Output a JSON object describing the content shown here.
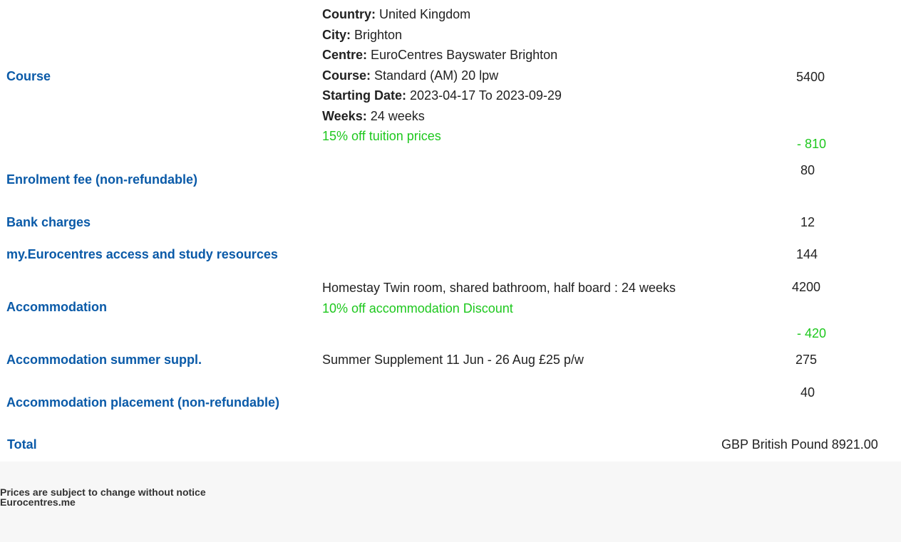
{
  "course": {
    "label": "Course",
    "country_key": "Country:",
    "country_val": "United Kingdom",
    "city_key": "City:",
    "city_val": "Brighton",
    "centre_key": "Centre:",
    "centre_val": "EuroCentres Bayswater Brighton",
    "course_key": "Course:",
    "course_val": "Standard (AM) 20 lpw",
    "date_key": "Starting Date:",
    "date_val": "2023-04-17 To 2023-09-29",
    "weeks_key": "Weeks:",
    "weeks_val": "24 weeks",
    "discount_text": "15% off tuition prices",
    "amount": "5400",
    "discount_amount": "- 810"
  },
  "enrolment": {
    "label": "Enrolment fee (non-refundable)",
    "amount": "80"
  },
  "bank": {
    "label": "Bank charges",
    "amount": "12"
  },
  "resources": {
    "label": "my.Eurocentres access and study resources",
    "amount": "144"
  },
  "accommodation": {
    "label": "Accommodation",
    "detail": "Homestay Twin room, shared bathroom, half board : 24 weeks",
    "discount_text": "10% off accommodation Discount",
    "amount": "4200",
    "discount_amount": "- 420"
  },
  "summer": {
    "label": "Accommodation summer suppl.",
    "detail": "Summer Supplement 11 Jun - 26 Aug £25 p/w",
    "amount": "275"
  },
  "placement": {
    "label": "Accommodation placement (non-refundable)",
    "amount": "40"
  },
  "total": {
    "label": "Total",
    "value": "GBP British Pound 8921.00"
  },
  "footer": {
    "notice": "Prices are subject to change without notice",
    "site": "Eurocentres.me"
  },
  "colors": {
    "label_blue": "#0a5aa8",
    "discount_green": "#1ec81e",
    "footer_bg": "#f7f7f7"
  }
}
